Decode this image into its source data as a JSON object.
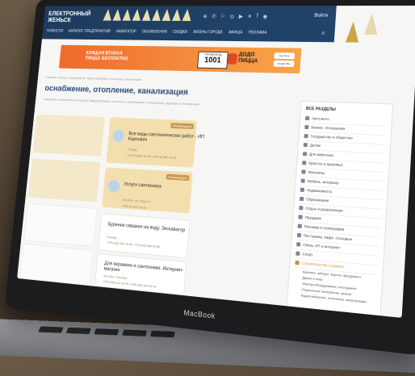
{
  "header": {
    "logo_line1": "ЕЛЕКТРОННЫЙ",
    "logo_line2": "ЖЕНЬСК",
    "login": "Войти",
    "nav": [
      "Новости",
      "Каталог предприятий",
      "Навигатор",
      "Объявления",
      "Скидки",
      "Жизнь города",
      "Афиша",
      "Реклама"
    ],
    "social": [
      "⊕",
      "✆",
      "⚐",
      "◎",
      "▶",
      "✈",
      "f",
      "◉"
    ]
  },
  "banner": {
    "text_line1": "КАЖДАЯ ВТОРАЯ",
    "text_line2": "ПИЦЦА БЕСПЛАТНО",
    "promo_label": "ПРОМОКОД",
    "promo_code": "1001",
    "brand_line1": "ДОДО",
    "brand_line2": "ПИЦЦА",
    "app1": "App Store",
    "app2": "Google Play"
  },
  "page": {
    "breadcrumb": "Главная / Каталог предприятий / Водоснабжение, отопление, канализация",
    "title": "оснабжение, отопление, канализация",
    "intro": "Подборка организаций в категории «водоснабжение, отопление, канализация» с контактами, адресами и телефонами."
  },
  "cards": [
    {
      "name": "Все виды сантехнических работ - ИП Карпович",
      "addr": "Ограда",
      "phones": "+375 29 682 22 00   +375 44 682 22 00",
      "badge": "Рекомендуем",
      "highlight": true
    },
    {
      "name": "Услуги сантехника",
      "addr": "Жлобин, ул. Мира 21",
      "phones": "+375 29 622 22 22",
      "badge": "Рекомендуем",
      "highlight": true
    },
    {
      "name": "Бурение скважин на воду. Экскаватор",
      "addr": "Ограда",
      "phones": "+375 (33) 333 19 80   +375 (44) 908 09 28",
      "badge": "",
      "highlight": false
    },
    {
      "name": "Для керамики и сантехники. Интернет-магазин",
      "addr": "Жлобин, Октября",
      "phones": "+375 (33) 312 92 91   +375 (33) 392 92 92",
      "badge": "",
      "highlight": false
    }
  ],
  "sidebar": {
    "heading": "ВСЕ РАЗДЕЛЫ",
    "items": [
      "Авто-мото",
      "Бизнес. Отношения",
      "Государство и общество",
      "Детям",
      "Для животных",
      "Красота и здоровье",
      "Магазины",
      "Мебель, интерьер",
      "Недвижимость",
      "Образование",
      "Отдых и развлечения",
      "Праздник",
      "Реклама и полиграфия",
      "Рестораны, кафе, столовые",
      "Связь, ИТ и интернет",
      "Спорт",
      "Строительство и ремонт"
    ],
    "subitems": [
      "Бурение, заборы, ворота, фундамент",
      "Двери и окна",
      "Электрооборудование, инструмент",
      "Отделочные материалы, краски",
      "Водоснабжение, отопление, канализация"
    ]
  },
  "footer": {
    "brand": "MacBook"
  }
}
